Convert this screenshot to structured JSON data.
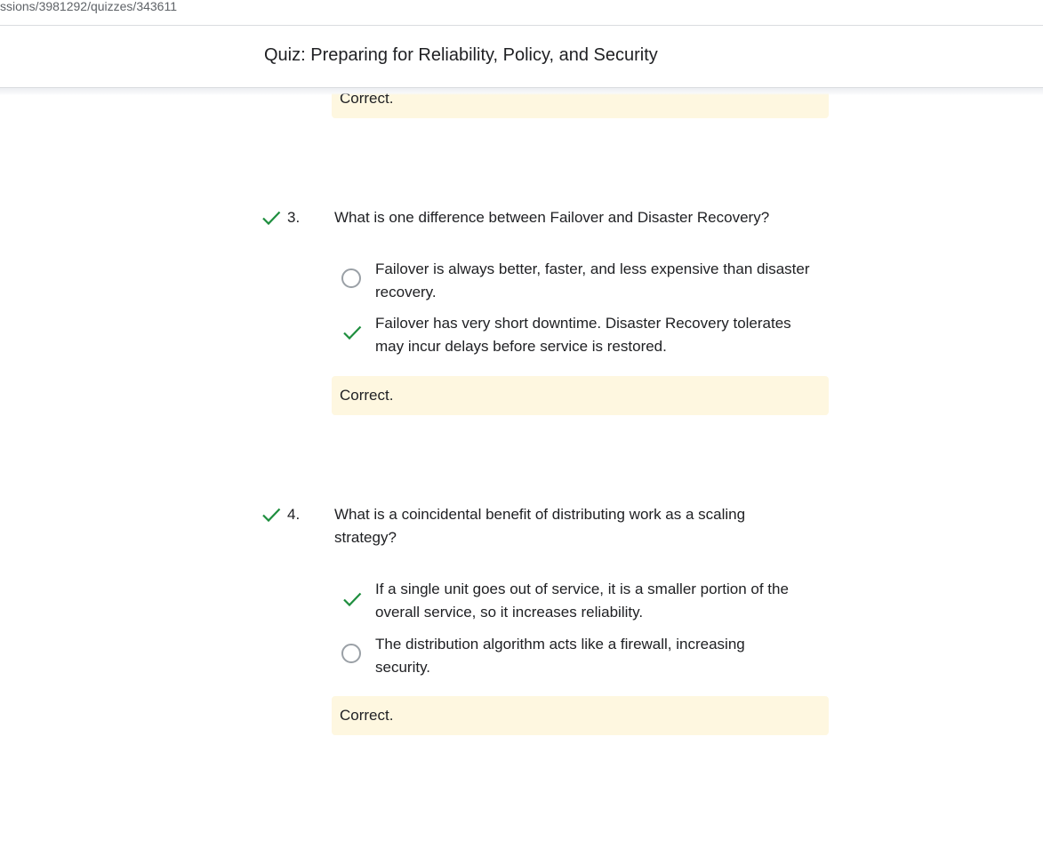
{
  "browser": {
    "url_fragment": "ssions/3981292/quizzes/343611"
  },
  "header": {
    "title": "Quiz: Preparing for Reliability, Policy, and Security"
  },
  "colors": {
    "correct_green": "#1e8e3e",
    "feedback_bg": "#fef7e0",
    "radio_gray": "#9aa0a6"
  },
  "previous_feedback": "Correct.",
  "questions": [
    {
      "number": "3.",
      "status_icon": "check-icon",
      "text": "What is one difference between Failover and Disaster Recovery?",
      "options": [
        {
          "line1": "Failover is always better, faster, and less expensive than disaster",
          "line2": "recovery.",
          "selected": false
        },
        {
          "line1": "Failover has very short downtime. Disaster Recovery tolerates",
          "line2": "may incur delays before service is restored.",
          "selected": true
        }
      ],
      "feedback": "Correct."
    },
    {
      "number": "4.",
      "status_icon": "check-icon",
      "text_line1": "What is a coincidental benefit of distributing work as a scaling",
      "text_line2": "strategy?",
      "options": [
        {
          "line1": "If a single unit goes out of service, it is a smaller portion of the",
          "line2": "overall service, so it increases reliability.",
          "selected": true
        },
        {
          "line1": "The distribution algorithm acts like a firewall, increasing",
          "line2": "security.",
          "selected": false
        }
      ],
      "feedback": "Correct."
    }
  ]
}
